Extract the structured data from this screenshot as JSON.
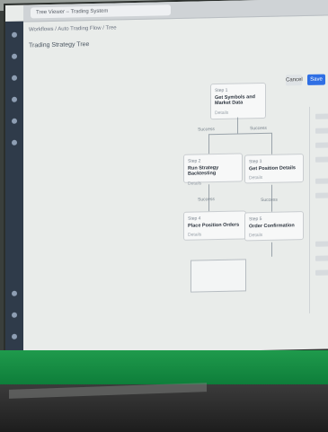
{
  "tabbar": {
    "tab_title": "Tree Viewer – Trading System"
  },
  "breadcrumb": "Workflows / Auto Trading Flow / Tree",
  "panel_title": "Trading Strategy Tree",
  "buttons": {
    "cancel": "Cancel",
    "primary": "Save"
  },
  "nodes": [
    {
      "header": "Step 1",
      "title": "Get Symbols and Market Data",
      "sub": "Details"
    },
    {
      "header": "Step 2",
      "title": "Run Strategy Backtesting",
      "sub": "Details"
    },
    {
      "header": "Step 3",
      "title": "Get Position Details",
      "sub": "Details"
    },
    {
      "header": "Step 4",
      "title": "Place Position Orders",
      "sub": "Details"
    },
    {
      "header": "Step 5",
      "title": "Order Confirmation",
      "sub": "Details"
    }
  ],
  "edge_labels": [
    "Success",
    "Success",
    "Success",
    "Success"
  ]
}
